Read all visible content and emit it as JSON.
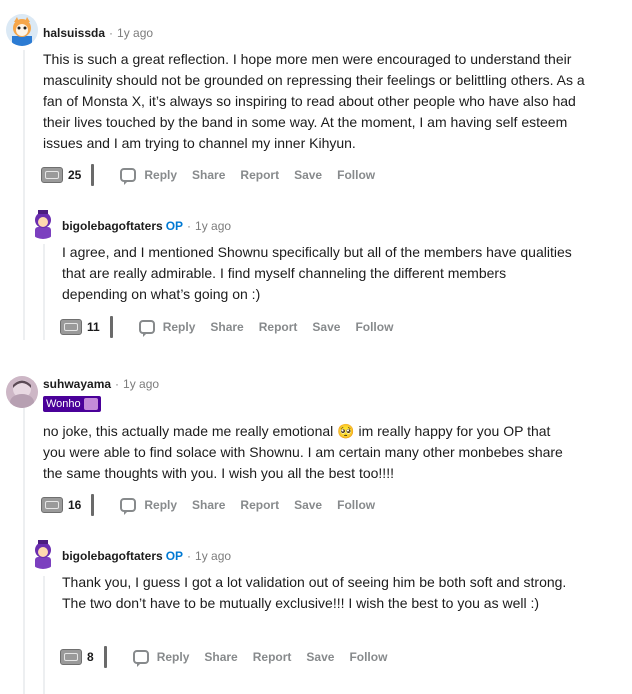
{
  "comments": [
    {
      "author": "halsuissda",
      "op_badge": "",
      "time": "1y ago",
      "flair": "",
      "body": "This is such a great reflection. I hope more men were encouraged to understand their masculinity should not be grounded on repressing their feelings or belittling others. As a fan of Monsta X, it’s always so inspiring to read about other people who have also had their lives touched by the band in some way. At the moment, I am having self esteem issues and I am trying to channel my inner Kihyun.",
      "votes": "25",
      "actions": [
        "Reply",
        "Share",
        "Report",
        "Save",
        "Follow"
      ]
    },
    {
      "author": "bigolebagoftaters",
      "op_badge": "OP",
      "time": "1y ago",
      "flair": "",
      "body": "I agree, and I mentioned Shownu specifically but all of the members have qualities that are really admirable. I find myself channeling the different members depending on what’s going on :)",
      "votes": "11",
      "actions": [
        "Reply",
        "Share",
        "Report",
        "Save",
        "Follow"
      ]
    },
    {
      "author": "suhwayama",
      "op_badge": "",
      "time": "1y ago",
      "flair": "Wonho",
      "body_part1": "no joke, this actually made me really emotional",
      "body_part2": " im really happy for you OP that you were able to find solace with Shownu. I am certain many other monbebes share the same thoughts with you. I wish you all the best too!!!!",
      "emoji": "🥺",
      "votes": "16",
      "actions": [
        "Reply",
        "Share",
        "Report",
        "Save",
        "Follow"
      ]
    },
    {
      "author": "bigolebagoftaters",
      "op_badge": "OP",
      "time": "1y ago",
      "flair": "",
      "body": "Thank you, I guess I got a lot validation out of seeing him be both soft and strong. The two don’t have to be mutually exclusive!!! I wish the best to you as well :)",
      "votes": "8",
      "actions": [
        "Reply",
        "Share",
        "Report",
        "Save",
        "Follow"
      ]
    }
  ],
  "separator": "·",
  "colors": {
    "op": "#0079d3",
    "flair_bg": "#4a0099",
    "action": "#878a8c"
  }
}
